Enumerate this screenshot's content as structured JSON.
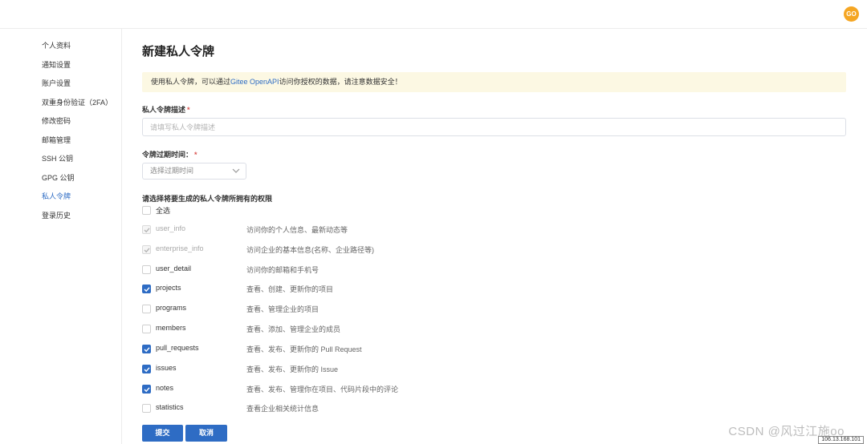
{
  "header": {
    "avatar_text": "GO",
    "avatar_color": "#f5a623"
  },
  "sidebar": {
    "items": [
      {
        "label": "个人资料",
        "active": false
      },
      {
        "label": "通知设置",
        "active": false
      },
      {
        "label": "账户设置",
        "active": false
      },
      {
        "label": "双重身份验证（2FA）",
        "active": false
      },
      {
        "label": "修改密码",
        "active": false
      },
      {
        "label": "邮箱管理",
        "active": false
      },
      {
        "label": "SSH 公钥",
        "active": false
      },
      {
        "label": "GPG 公钥",
        "active": false
      },
      {
        "label": "私人令牌",
        "active": true
      },
      {
        "label": "登录历史",
        "active": false
      }
    ]
  },
  "main": {
    "title": "新建私人令牌",
    "notice": {
      "prefix": "使用私人令牌，可以通过",
      "link": "Gitee OpenAPI",
      "suffix": "访问你授权的数据，请注意数据安全！"
    },
    "desc_label": "私人令牌描述",
    "desc_placeholder": "请填写私人令牌描述",
    "required_mark": "*",
    "expire_label": "令牌过期时间：",
    "expire_placeholder": "选择过期时间",
    "perm_title": "请选择将要生成的私人令牌所拥有的权限",
    "select_all": "全选",
    "permissions": [
      {
        "name": "user_info",
        "desc": "访问你的个人信息、最新动态等",
        "checked": true,
        "disabled": true
      },
      {
        "name": "enterprise_info",
        "desc": "访问企业的基本信息(名称、企业路径等)",
        "checked": true,
        "disabled": true
      },
      {
        "name": "user_detail",
        "desc": "访问你的邮箱和手机号",
        "checked": false,
        "disabled": false
      },
      {
        "name": "projects",
        "desc": "查看、创建、更新你的项目",
        "checked": true,
        "disabled": false
      },
      {
        "name": "programs",
        "desc": "查看、管理企业的项目",
        "checked": false,
        "disabled": false
      },
      {
        "name": "members",
        "desc": "查看、添加、管理企业的成员",
        "checked": false,
        "disabled": false
      },
      {
        "name": "pull_requests",
        "desc": "查看、发布、更新你的 Pull Request",
        "checked": true,
        "disabled": false
      },
      {
        "name": "issues",
        "desc": "查看、发布、更新你的 Issue",
        "checked": true,
        "disabled": false
      },
      {
        "name": "notes",
        "desc": "查看、发布、管理你在项目、代码片段中的评论",
        "checked": true,
        "disabled": false
      },
      {
        "name": "statistics",
        "desc": "查看企业相关统计信息",
        "checked": false,
        "disabled": false
      }
    ],
    "submit_label": "提交",
    "cancel_label": "取消"
  },
  "watermark": "CSDN @风过江施oo",
  "ip_tag": "106.13.168.101",
  "colors": {
    "accent": "#2e6cc4",
    "notice_bg": "#fcf8e3",
    "required": "#d9534f"
  }
}
